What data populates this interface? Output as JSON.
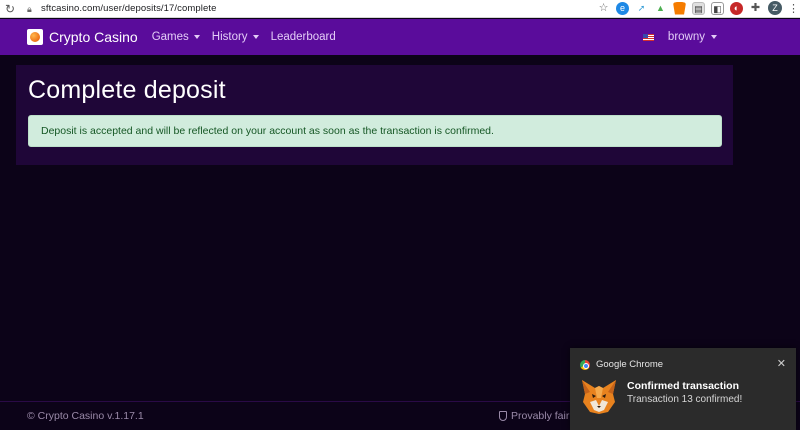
{
  "browser": {
    "url": "sftcasino.com/user/deposits/17/complete",
    "profile_initial": "Z"
  },
  "navbar": {
    "brand": "Crypto Casino",
    "links": [
      {
        "label": "Games",
        "dropdown": true
      },
      {
        "label": "History",
        "dropdown": true
      },
      {
        "label": "Leaderboard",
        "dropdown": false
      }
    ],
    "username": "browny"
  },
  "main": {
    "title": "Complete deposit",
    "alert": "Deposit is accepted and will be reflected on your account as soon as the transaction is confirmed."
  },
  "footer": {
    "copyright": "© Crypto Casino v.1.17.1",
    "provably_fair": "Provably fair"
  },
  "notification": {
    "app": "Google Chrome",
    "title": "Confirmed transaction",
    "body": "Transaction 13 confirmed!"
  },
  "colors": {
    "navbar": "#5a0c9b",
    "background": "#0c0318",
    "card": "#1f0638",
    "alert_bg": "#d1ecdd",
    "alert_text": "#155724"
  }
}
